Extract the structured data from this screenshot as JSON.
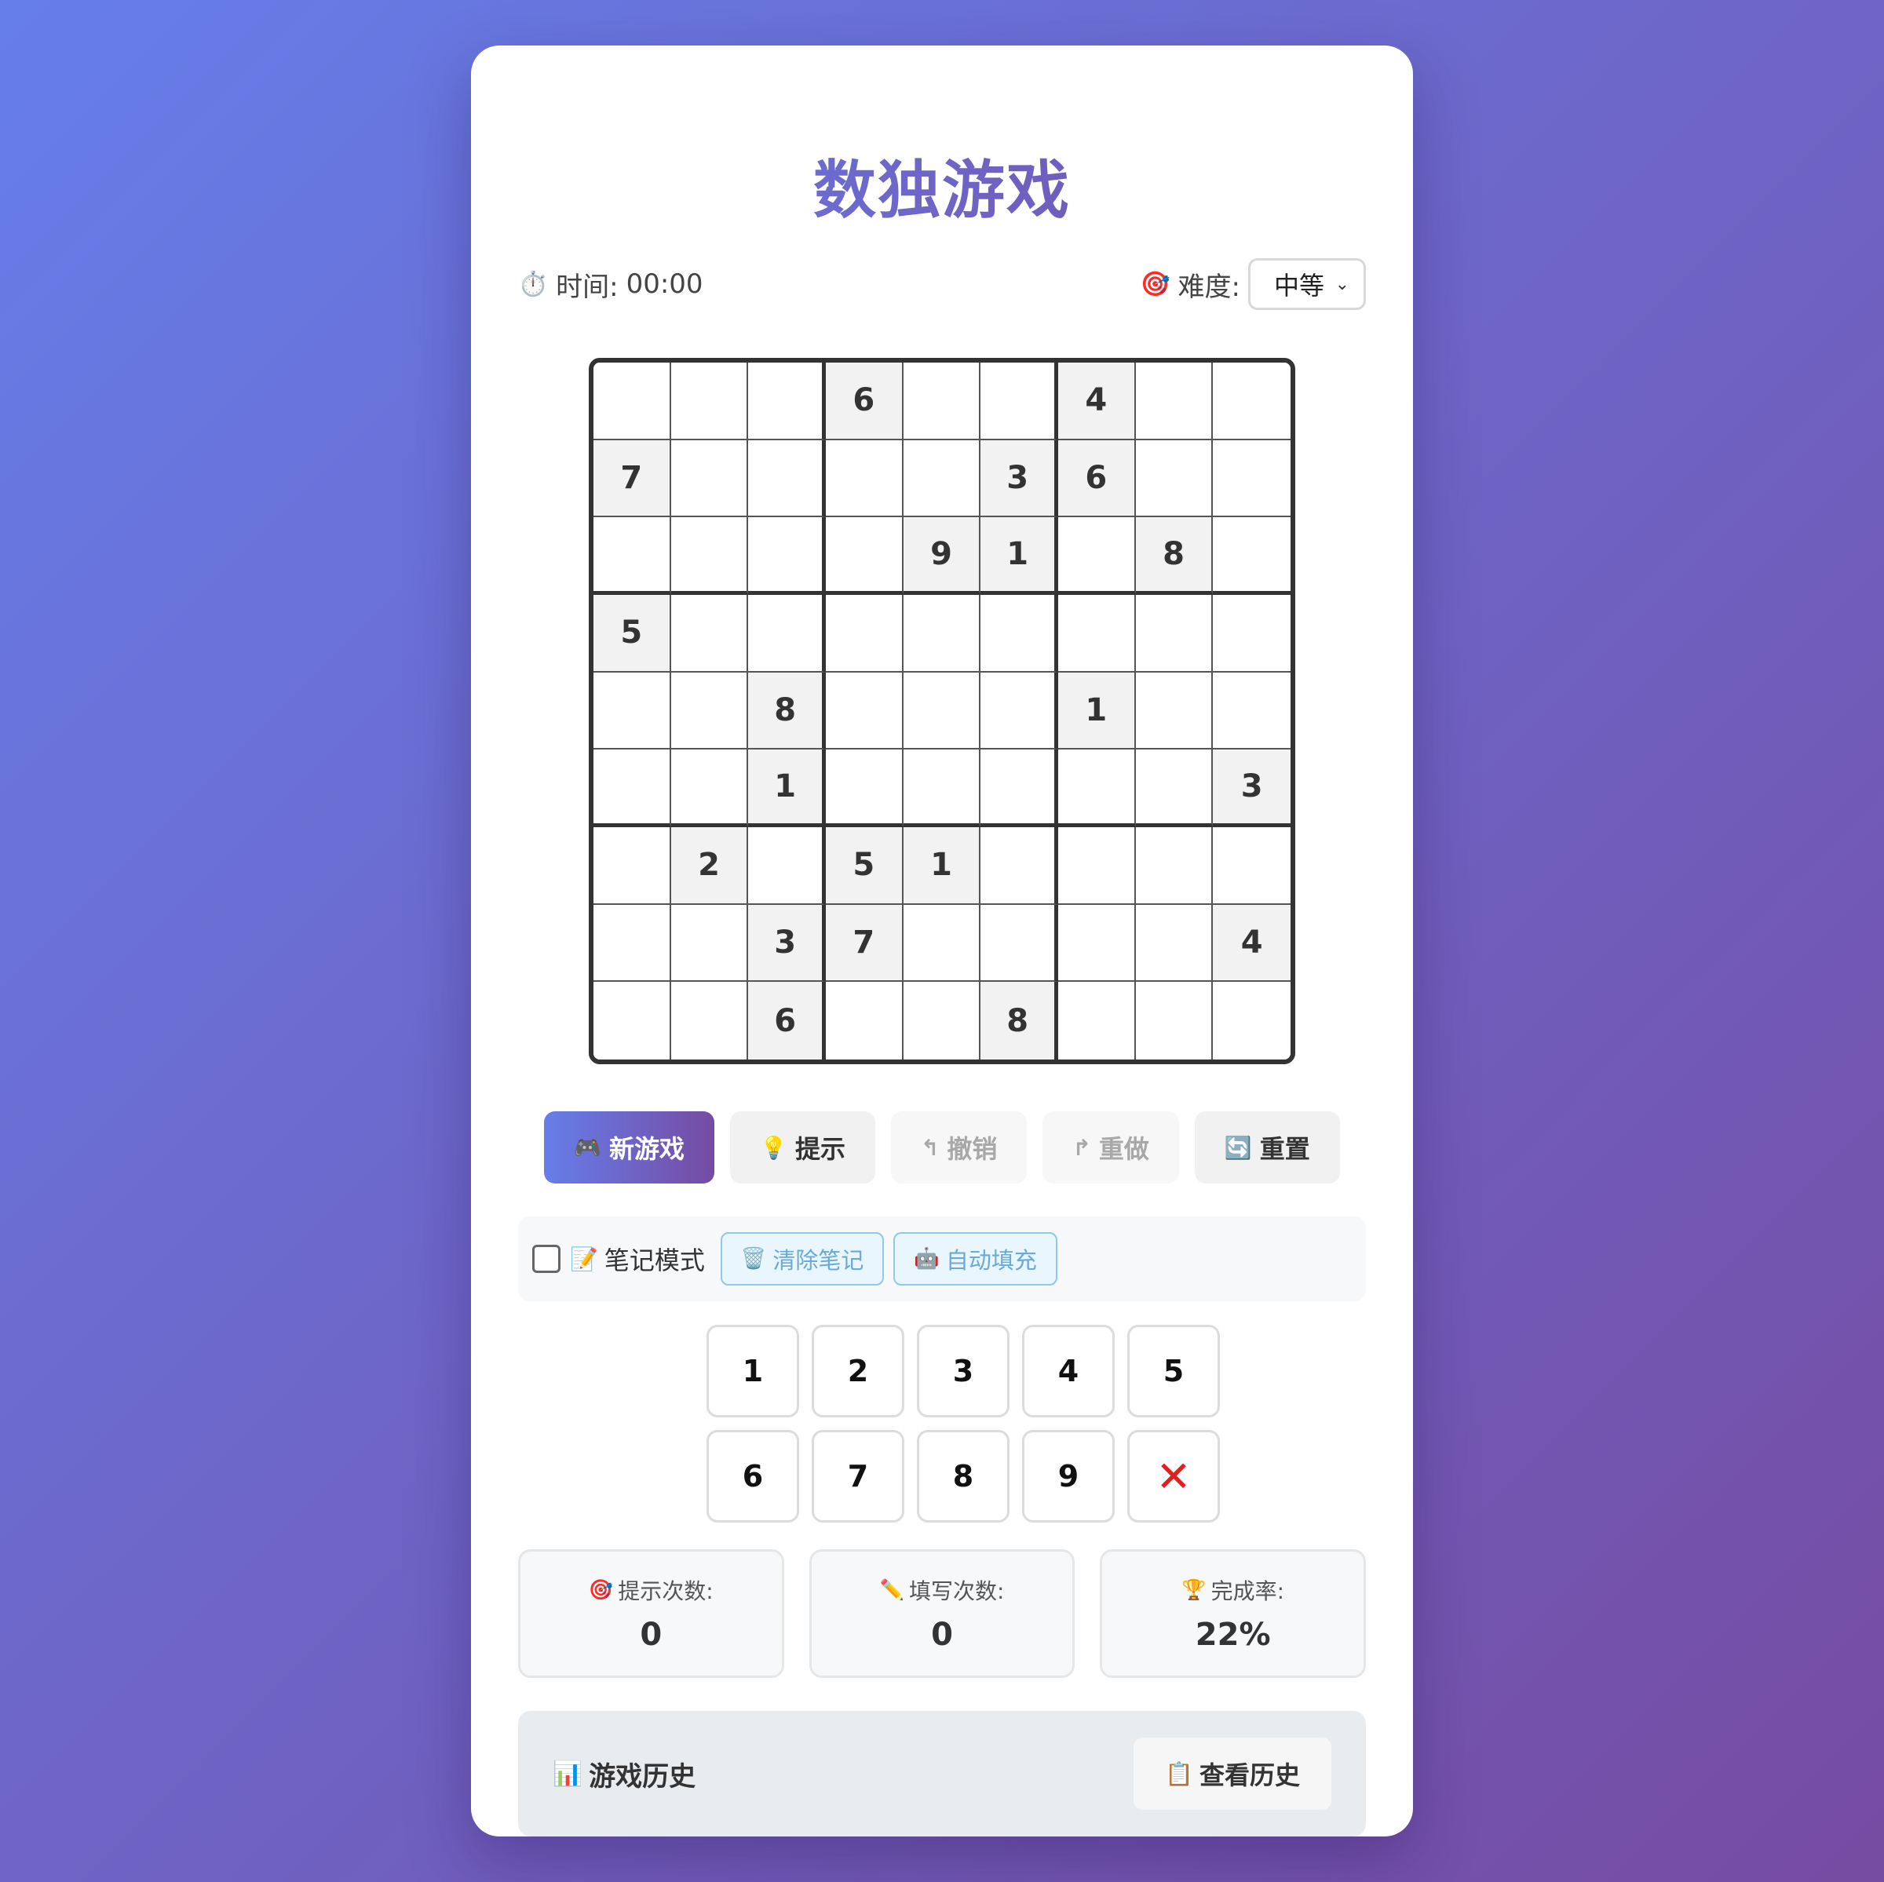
{
  "title": "数独游戏",
  "timer": {
    "icon": "⏱️",
    "label": "时间:",
    "value": "00:00"
  },
  "difficulty": {
    "icon": "🎯",
    "label": "难度:",
    "selected": "中等"
  },
  "board": [
    [
      "",
      "",
      "",
      "6",
      "",
      "",
      "4",
      "",
      ""
    ],
    [
      "7",
      "",
      "",
      "",
      "",
      "3",
      "6",
      "",
      ""
    ],
    [
      "",
      "",
      "",
      "",
      "9",
      "1",
      "",
      "8",
      ""
    ],
    [
      "5",
      "",
      "",
      "",
      "",
      "",
      "",
      "",
      ""
    ],
    [
      "",
      "",
      "8",
      "",
      "",
      "",
      "1",
      "",
      ""
    ],
    [
      "",
      "",
      "1",
      "",
      "",
      "",
      "",
      "",
      "3"
    ],
    [
      "",
      "2",
      "",
      "5",
      "1",
      "",
      "",
      "",
      ""
    ],
    [
      "",
      "",
      "3",
      "7",
      "",
      "",
      "",
      "",
      "4"
    ],
    [
      "",
      "",
      "6",
      "",
      "",
      "8",
      "",
      "",
      ""
    ]
  ],
  "controls": {
    "new_game": {
      "icon": "🎮",
      "label": "新游戏"
    },
    "hint": {
      "icon": "💡",
      "label": "提示"
    },
    "undo": {
      "icon": "↰",
      "label": "撤销"
    },
    "redo": {
      "icon": "↱",
      "label": "重做"
    },
    "reset": {
      "icon": "🔄",
      "label": "重置"
    }
  },
  "notes": {
    "icon": "📝",
    "label": "笔记模式",
    "checked": false,
    "clear": {
      "icon": "🗑️",
      "label": "清除笔记"
    },
    "autofill": {
      "icon": "🤖",
      "label": "自动填充"
    }
  },
  "numpad": [
    "1",
    "2",
    "3",
    "4",
    "5",
    "6",
    "7",
    "8",
    "9"
  ],
  "erase_symbol": "✕",
  "stats": {
    "hints": {
      "icon": "🎯",
      "label": "提示次数:",
      "value": "0"
    },
    "fills": {
      "icon": "✏️",
      "label": "填写次数:",
      "value": "0"
    },
    "completion": {
      "icon": "🏆",
      "label": "完成率:",
      "value": "22%"
    }
  },
  "history": {
    "icon": "📊",
    "title": "游戏历史",
    "button": {
      "icon": "📋",
      "label": "查看历史"
    }
  },
  "colors": {
    "accent_start": "#667eea",
    "accent_end": "#764ba2",
    "erase": "#e02020"
  }
}
